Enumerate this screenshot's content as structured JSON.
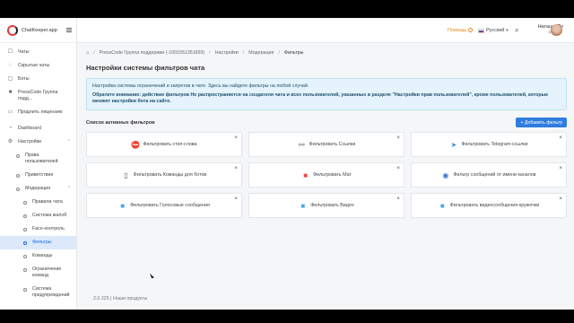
{
  "brand": {
    "name": "ChatKeeper.app"
  },
  "sidebar": {
    "items": [
      {
        "label": "Чаты",
        "icon": "chat-icon"
      },
      {
        "label": "Скрытые чаты",
        "icon": "eye-off-icon"
      },
      {
        "label": "Боты",
        "icon": "bot-icon"
      },
      {
        "label": "PressCode Группа подд...",
        "icon": "group-icon"
      },
      {
        "label": "Продлить лицензию",
        "icon": "card-icon"
      },
      {
        "label": "Dashboard",
        "icon": "dashboard-icon"
      },
      {
        "label": "Настройки",
        "icon": "gear-icon"
      },
      {
        "label": "Права пользователей"
      },
      {
        "label": "Приветствие"
      },
      {
        "label": "Модерация"
      },
      {
        "label": "Правила чата"
      },
      {
        "label": "Система жалоб"
      },
      {
        "label": "Face-контроль"
      },
      {
        "label": "Фильтры"
      },
      {
        "label": "Команды"
      },
      {
        "label": "Ограничение команд"
      },
      {
        "label": "Система предупреждений"
      }
    ]
  },
  "topbar": {
    "help": "Помощь",
    "language": "Русский",
    "user_name": "Наташа Пе",
    "user_handle": "@user..."
  },
  "breadcrumbs": [
    "PressCode Группа поддержки (-1001551351893)",
    "Настройки",
    "Модерация",
    "Фильтры"
  ],
  "page": {
    "title": "Настройки системы фильтров чата",
    "info_line": "Настройка системы ограничений и запретов в чате. Здесь вы найдете фильтры на любой случай.",
    "info_warning": "Обратите внимание: действие фильтров Не распространяется на создателя чата и всех пользователей, указанных в разделе \"Настройки прав пользователей\", кроме пользователей, которые меняют настройки бота на сайте.",
    "list_title": "Список активных фильтров",
    "add_button": "+ Добавить фильтр"
  },
  "filters": [
    {
      "label": "Фильтровать стоп-слова",
      "icon": "stop-icon",
      "color": "#e54848"
    },
    {
      "label": "Фильтровать Ссылки",
      "icon": "link-icon",
      "color": "#666666"
    },
    {
      "label": "Фильтровать Telegram-ссылки",
      "icon": "telegram-icon",
      "color": "#3a8fd9"
    },
    {
      "label": "Фильтровать Команды для ботов",
      "icon": "phone-icon",
      "color": "#555555"
    },
    {
      "label": "Фильтровать Мат",
      "icon": "swear-icon",
      "color": "#e54848"
    },
    {
      "label": "Фильтр сообщений от имени каналов",
      "icon": "broadcast-icon",
      "color": "#3a6fd9"
    },
    {
      "label": "Фильтровать Голосовые сообщения",
      "icon": "voice-icon",
      "color": "#4aa8e8"
    },
    {
      "label": "Фильтровать Видео",
      "icon": "video-icon",
      "color": "#4aa8e8"
    },
    {
      "label": "Фильтровать видеосообщения-кружочки",
      "icon": "video-message-icon",
      "color": "#4aa8e8"
    }
  ],
  "footer": {
    "version": "2.0.225",
    "separator": "|",
    "link": "Наши продукты"
  }
}
